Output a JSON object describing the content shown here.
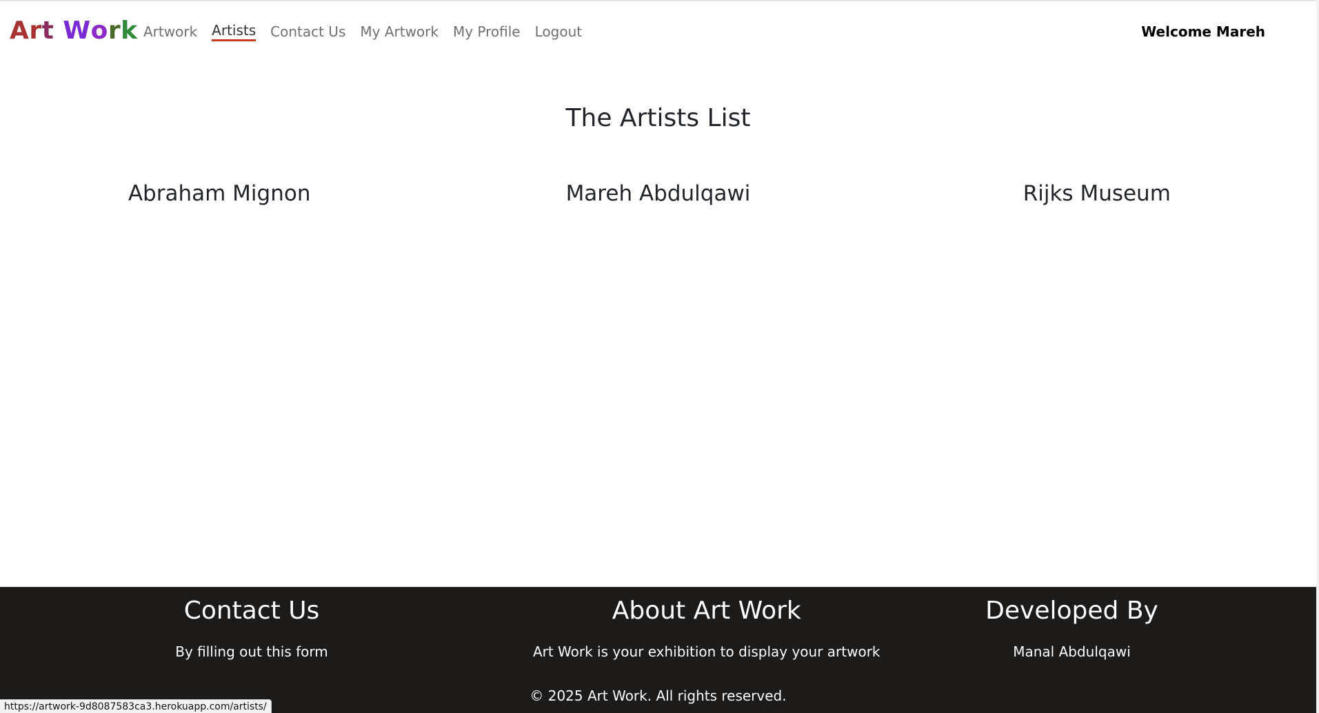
{
  "brand": {
    "letters": [
      {
        "char": "A",
        "color": "#a83232"
      },
      {
        "char": "r",
        "color": "#a83232"
      },
      {
        "char": "t",
        "color": "#8a2d5e"
      },
      {
        "char": " ",
        "color": "#ffffff"
      },
      {
        "char": "W",
        "color": "#7b2bd6"
      },
      {
        "char": "o",
        "color": "#8e2bc8"
      },
      {
        "char": "r",
        "color": "#4a6a2a"
      },
      {
        "char": "k",
        "color": "#2f8a3a"
      }
    ]
  },
  "nav": {
    "items": [
      {
        "label": "Artwork",
        "active": false
      },
      {
        "label": "Artists",
        "active": true
      },
      {
        "label": "Contact Us",
        "active": false
      },
      {
        "label": "My Artwork",
        "active": false
      },
      {
        "label": "My Profile",
        "active": false
      },
      {
        "label": "Logout",
        "active": false
      }
    ],
    "welcome": "Welcome Mareh"
  },
  "main": {
    "title": "The Artists List",
    "artists": [
      "Abraham Mignon",
      "Mareh Abdulqawi",
      "Rijks Museum"
    ]
  },
  "footer": {
    "contact": {
      "heading": "Contact Us",
      "text": "By filling out this form"
    },
    "about": {
      "heading": "About Art Work",
      "text": "Art Work is your exhibition to display your artwork"
    },
    "developed": {
      "heading": "Developed By",
      "text": "Manal Abdulqawi"
    },
    "copyright": "© 2025 Art Work. All rights reserved."
  },
  "status_bar": {
    "url": "https://artwork-9d8087583ca3.herokuapp.com/artists/"
  },
  "colors": {
    "active_underline": "#c93a1f",
    "footer_bg": "#1c1b1a",
    "nav_link": "#707070"
  }
}
